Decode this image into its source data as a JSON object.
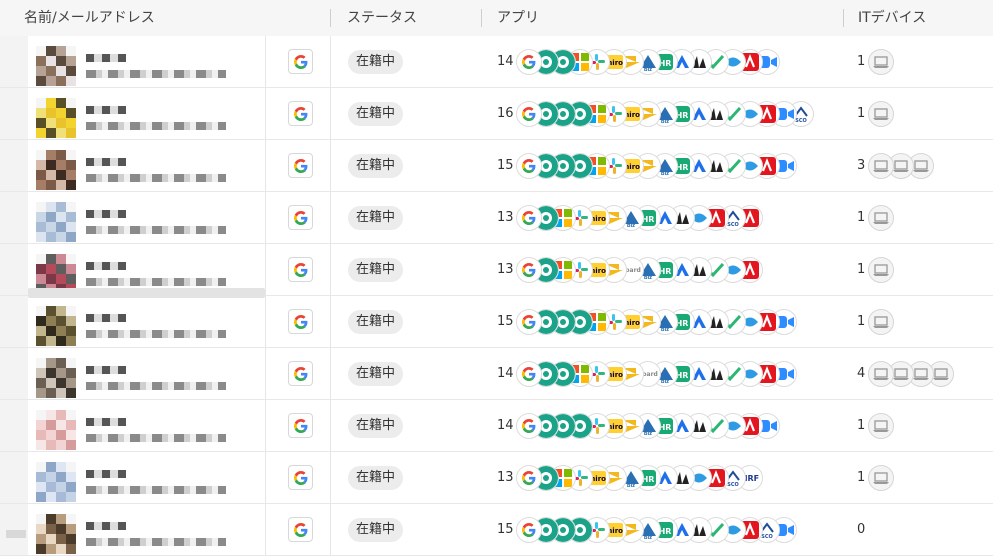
{
  "columns": {
    "name": "名前/メールアドレス",
    "status": "ステータス",
    "apps": "アプリ",
    "devices": "ITデバイス"
  },
  "rows": [
    {
      "status": "在籍中",
      "app_count": "14",
      "device_count": "1",
      "device_icons": 1,
      "apps": [
        "google",
        "chatwork",
        "chatwork",
        "ms365",
        "slack",
        "miro",
        "zendesk",
        "chatwork-biz",
        "jira",
        "airtable",
        "atlassian",
        "notion",
        "freee",
        "adobe",
        "zoom"
      ]
    },
    {
      "status": "在籍中",
      "app_count": "16",
      "device_count": "1",
      "device_icons": 1,
      "apps": [
        "google",
        "chatwork",
        "chatwork",
        "chatwork",
        "ms365",
        "slack",
        "miro",
        "zendesk",
        "chatwork-biz",
        "jira",
        "airtable",
        "atlassian",
        "notion",
        "freee",
        "adobe",
        "zoom",
        "scrum"
      ]
    },
    {
      "status": "在籍中",
      "app_count": "15",
      "device_count": "3",
      "device_icons": 3,
      "apps": [
        "google",
        "chatwork",
        "chatwork",
        "chatwork",
        "ms365",
        "slack",
        "miro",
        "zendesk",
        "chatwork-biz",
        "jira",
        "airtable",
        "atlassian",
        "notion",
        "freee",
        "adobe",
        "zoom"
      ]
    },
    {
      "status": "在籍中",
      "app_count": "13",
      "device_count": "1",
      "device_icons": 1,
      "apps": [
        "google",
        "chatwork",
        "ms365",
        "slack",
        "miro",
        "zendesk",
        "chatwork-biz",
        "jira",
        "airtable",
        "atlassian",
        "freee",
        "adobe",
        "scrum",
        "acrobat"
      ]
    },
    {
      "status": "在籍中",
      "app_count": "13",
      "device_count": "1",
      "device_icons": 1,
      "apps": [
        "google",
        "chatwork",
        "ms365",
        "slack",
        "miro",
        "zendesk",
        "board",
        "chatwork-biz",
        "jira",
        "airtable",
        "atlassian",
        "notion",
        "freee",
        "adobe"
      ]
    },
    {
      "status": "在籍中",
      "app_count": "15",
      "device_count": "1",
      "device_icons": 1,
      "apps": [
        "google",
        "chatwork",
        "chatwork",
        "chatwork",
        "ms365",
        "slack",
        "miro",
        "zendesk",
        "chatwork-biz",
        "jira",
        "airtable",
        "atlassian",
        "notion",
        "freee",
        "adobe",
        "zoom"
      ]
    },
    {
      "status": "在籍中",
      "app_count": "14",
      "device_count": "4",
      "device_icons": 4,
      "apps": [
        "google",
        "chatwork",
        "chatwork",
        "ms365",
        "slack",
        "miro",
        "zendesk",
        "board",
        "chatwork-biz",
        "jira",
        "airtable",
        "atlassian",
        "notion",
        "freee",
        "acrobat",
        "zoom"
      ]
    },
    {
      "status": "在籍中",
      "app_count": "14",
      "device_count": "1",
      "device_icons": 1,
      "apps": [
        "google",
        "chatwork",
        "chatwork",
        "chatwork",
        "slack",
        "miro",
        "zendesk",
        "chatwork-biz",
        "jira",
        "airtable",
        "atlassian",
        "notion",
        "freee",
        "adobe",
        "zoom"
      ]
    },
    {
      "status": "在籍中",
      "app_count": "13",
      "device_count": "1",
      "device_icons": 1,
      "apps": [
        "google",
        "chatwork",
        "ms365",
        "slack",
        "miro",
        "zendesk",
        "chatwork-biz",
        "jira",
        "airtable",
        "atlassian",
        "freee",
        "adobe",
        "scrum",
        "nrf"
      ]
    },
    {
      "status": "在籍中",
      "app_count": "15",
      "device_count": "0",
      "device_icons": 0,
      "apps": [
        "google",
        "chatwork",
        "chatwork",
        "chatwork",
        "slack",
        "miro",
        "zendesk",
        "chatwork-biz",
        "jira",
        "airtable",
        "atlassian",
        "notion",
        "freee",
        "adobe",
        "scrum",
        "zoom"
      ]
    }
  ],
  "app_labels": {
    "ms365": "▦",
    "slack": "✚",
    "zendesk": "▲",
    "jira": "≡",
    "notion": "N"
  },
  "avatar_palettes": [
    [
      "#e8e2e4",
      "#8a6f5a",
      "#b7a296",
      "#5b4a3e"
    ],
    [
      "#f2d32f",
      "#e9c32c",
      "#f0e07a",
      "#5a5028"
    ],
    [
      "#7c5a48",
      "#a67d66",
      "#3d2b22",
      "#d4b8a8"
    ],
    [
      "#c9d6e6",
      "#a8bcd6",
      "#dbe4ef",
      "#8fa7c7"
    ],
    [
      "#b44a5a",
      "#7b3947",
      "#cc8894",
      "#5e5e5e"
    ],
    [
      "#5b5030",
      "#8f7f55",
      "#2f2a1c",
      "#c2b68e"
    ],
    [
      "#6a5f52",
      "#a69889",
      "#3b352d",
      "#cfc4b8"
    ],
    [
      "#f3d4d4",
      "#e8b9b9",
      "#f7e6e6",
      "#d69c9c"
    ],
    [
      "#c4d3e6",
      "#a7bbd8",
      "#dde6f2",
      "#8ea6c7"
    ],
    [
      "#4a3b2a",
      "#7a6248",
      "#e9d8c4",
      "#b89c7e"
    ]
  ],
  "colors": {
    "google_blue": "#4285F4",
    "google_red": "#EA4335",
    "google_yellow": "#FBBC05",
    "google_green": "#34A853",
    "chatwork": "#1aa389",
    "adobe": "#e3161f",
    "zoom": "#2d8cff"
  }
}
